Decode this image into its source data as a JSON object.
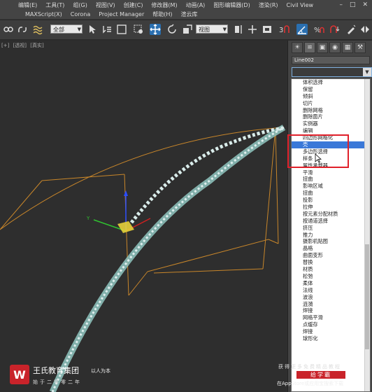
{
  "menubar": {
    "row1": [
      "编辑(E)",
      "工具(T)",
      "组(G)",
      "视图(V)",
      "创建(C)",
      "修改器(M)",
      "动画(A)",
      "图形编辑器(D)",
      "渲染(R)",
      "Civil View"
    ],
    "row2": [
      "MAXScript(X)",
      "Corona",
      "Project Manager",
      "帮助(H)",
      "渲云库"
    ]
  },
  "toolbar": {
    "selection_filter": "全部",
    "ref_coord": "视图"
  },
  "viewport": {
    "label_plus": "[+]",
    "label_view": "[透视]",
    "label_shading": "[真实]"
  },
  "command_panel": {
    "object_name": "Line002",
    "tab_icons": [
      "create-tab",
      "modify-tab",
      "hierarchy-tab",
      "motion-tab",
      "display-tab",
      "utilities-tab"
    ]
  },
  "modifiers": [
    "体积选择",
    "保留",
    "倾斜",
    "切片",
    "删除网格",
    "删除面片",
    "实例器",
    "编辑",
    "四边形网格化",
    "壳",
    "多边形选择",
    "样条",
    "属性承载器",
    "平滑",
    "扭曲",
    "影响区域",
    "扭曲",
    "投影",
    "拉伸",
    "按元素分配材质",
    "按通道选择",
    "挤压",
    "推力",
    "摄影机贴图",
    "晶格",
    "曲面变形",
    "替换",
    "材质",
    "松弛",
    "柔体",
    "法线",
    "波浪",
    "涟漪",
    "焊接",
    "网格平滑",
    "点缓存",
    "焊接",
    "球形化"
  ],
  "selected_modifier_index": 9,
  "watermark": {
    "logo_glyph": "W",
    "brand": "王氏教育集团",
    "motto": "以人为本",
    "since": "始于二零零二年",
    "right_line1": "获得更多免费精品教程",
    "right_badge": "给学霸",
    "right_line3": "在AppStore或应用宝搜索下载"
  },
  "colors": {
    "accent_blue": "#3a78d8",
    "highlight_red": "#e0202a",
    "spline_orange": "#c8862a",
    "brand_red": "#c9232a"
  }
}
